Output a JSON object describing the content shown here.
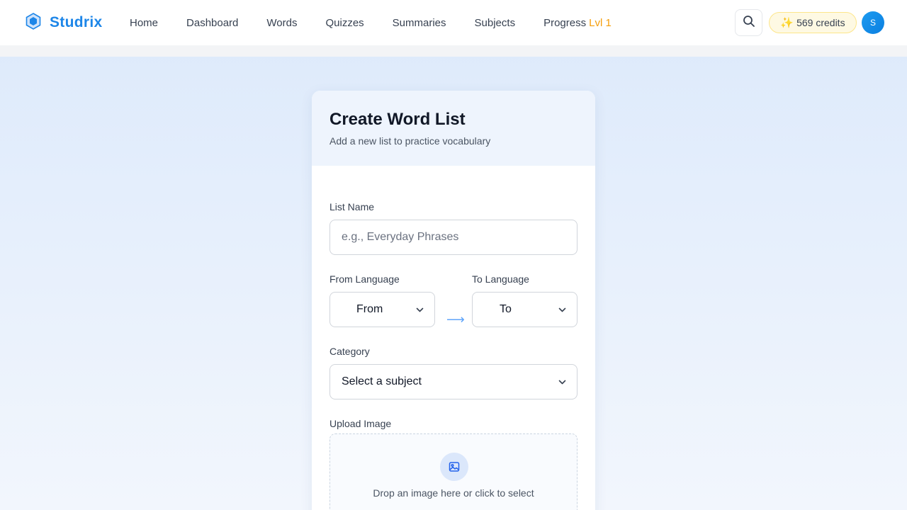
{
  "app": {
    "name": "Studrix",
    "brand_color": "#1d86e8"
  },
  "nav": {
    "items": [
      {
        "label": "Home"
      },
      {
        "label": "Dashboard"
      },
      {
        "label": "Words"
      },
      {
        "label": "Quizzes"
      },
      {
        "label": "Summaries"
      },
      {
        "label": "Subjects"
      }
    ],
    "progress_label": "Progress",
    "progress_level": "Lvl 1"
  },
  "header_right": {
    "search_icon": "search-icon",
    "credits_label": "569 credits",
    "credits_icon": "sparkles-icon",
    "avatar_initial": "S"
  },
  "form": {
    "title": "Create Word List",
    "subtitle": "Add a new list to practice vocabulary",
    "list_name": {
      "label": "List Name",
      "placeholder": "e.g., Everyday Phrases",
      "value": ""
    },
    "from_language": {
      "label": "From Language",
      "selected": "From"
    },
    "to_language": {
      "label": "To Language",
      "selected": "To"
    },
    "category": {
      "label": "Category",
      "selected": "Select a subject"
    },
    "upload": {
      "label": "Upload Image",
      "hint": "Drop an image here or click to select",
      "icon": "image-icon"
    }
  }
}
